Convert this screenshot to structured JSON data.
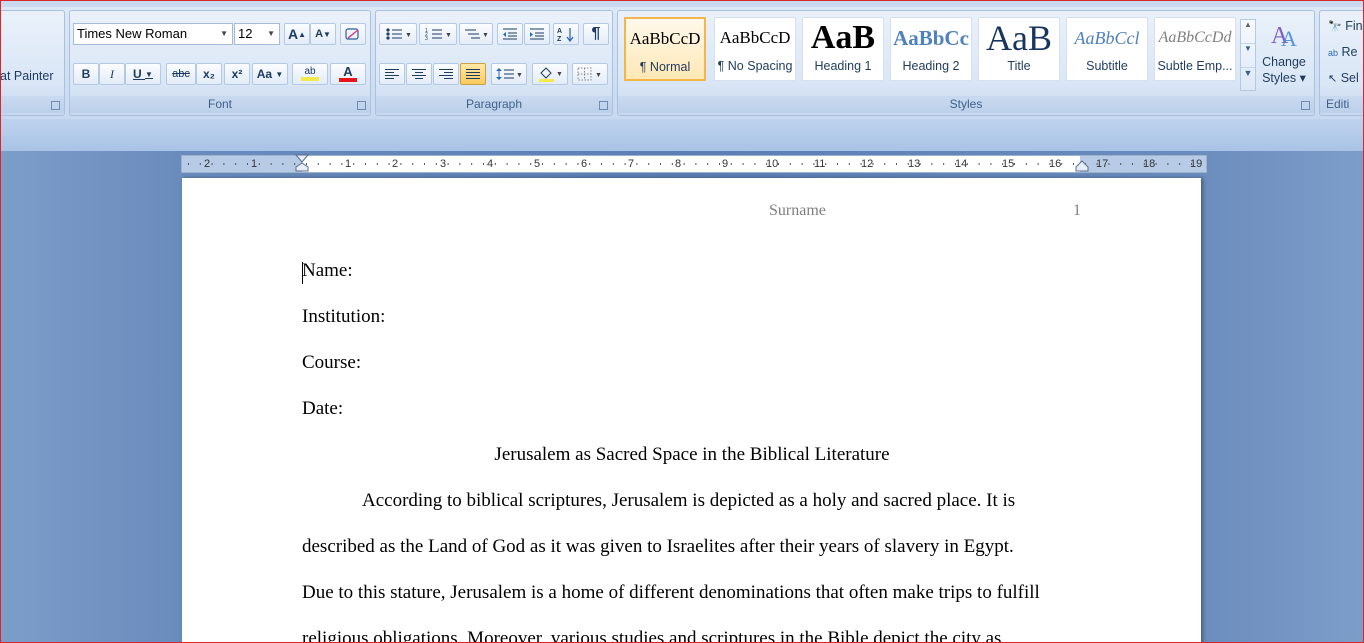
{
  "ribbon": {
    "clipboard": {
      "format_painter_label": "at Painter"
    },
    "font": {
      "label": "Font",
      "font_name": "Times New Roman",
      "font_size": "12",
      "grow_label": "A",
      "shrink_label": "A",
      "bold": "B",
      "italic": "I",
      "underline": "U",
      "strike": "abc",
      "subscript": "x₂",
      "superscript": "x²",
      "change_case": "Aa",
      "highlight": "ab",
      "font_color": "A"
    },
    "paragraph": {
      "label": "Paragraph",
      "pilcrow": "¶"
    },
    "styles": {
      "label": "Styles",
      "items": [
        {
          "sample": "AaBbCcD",
          "label": "¶ Normal"
        },
        {
          "sample": "AaBbCcD",
          "label": "¶ No Spacing"
        },
        {
          "sample": "AaB",
          "label": "Heading 1"
        },
        {
          "sample": "AaBbCc",
          "label": "Heading 2"
        },
        {
          "sample": "AaB",
          "label": "Title"
        },
        {
          "sample": "AaBbCcl",
          "label": "Subtitle"
        },
        {
          "sample": "AaBbCcDd",
          "label": "Subtle Emp..."
        }
      ],
      "change_styles_line1": "Change",
      "change_styles_line2": "Styles ▾"
    },
    "editing": {
      "label": "Editi",
      "find": "Fin",
      "replace": "Re",
      "select": "Sel"
    }
  },
  "ruler": {
    "ticks": [
      "2",
      "1",
      "1",
      "2",
      "3",
      "4",
      "5",
      "6",
      "7",
      "8",
      "9",
      "10",
      "11",
      "12",
      "13",
      "14",
      "15",
      "16",
      "17",
      "18",
      "19"
    ]
  },
  "document": {
    "header_surname": "Surname",
    "header_page": "1",
    "name": "Name:",
    "institution": "Institution:",
    "course": "Course:",
    "date": "Date:",
    "title": "Jerusalem as Sacred Space in the Biblical Literature",
    "p1": "According to biblical scriptures, Jerusalem is depicted as a holy and sacred place. It is",
    "p2": "described as the Land of God as it was given to Israelites after their years of slavery in Egypt.",
    "p3": "Due to this stature, Jerusalem is a home of different denominations that often make trips to fulfill",
    "p4": "religious obligations. Moreover, various studies and scriptures in the Bible depict the city as"
  },
  "colors": {
    "accent_highlight": "#f4e94a",
    "font_color_bar": "#e8141b",
    "frame_border": "#d9262b"
  }
}
